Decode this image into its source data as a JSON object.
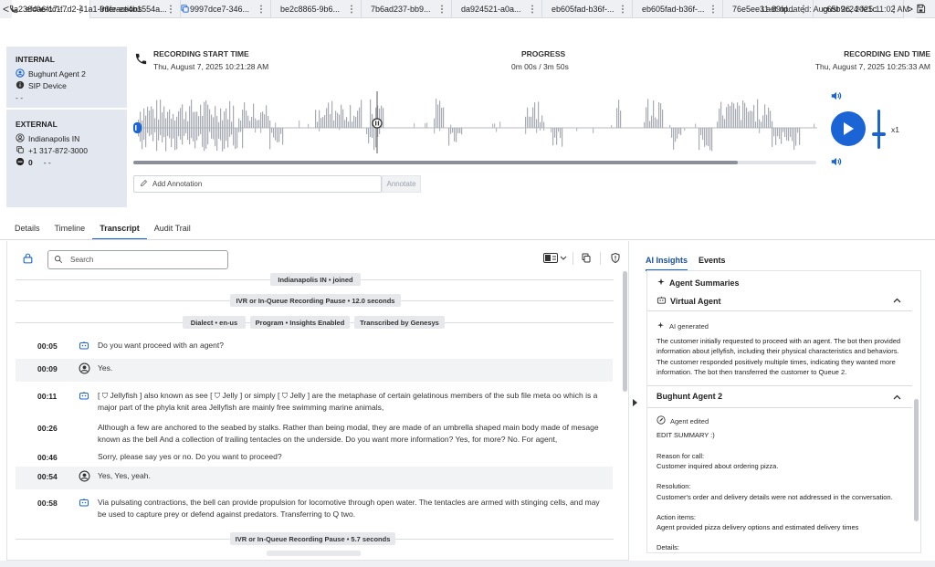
{
  "tabs": [
    "8a236c0e-cc1...",
    "Interactions",
    "9997dce7-346...",
    "be2c8865-9b6...",
    "7b6ad237-bb9...",
    "da924521-a0a...",
    "eb605fad-b36f-...",
    "eb605fad-b36f-...",
    "76e5ee31-89fd...",
    "c65b9c24-fe1c..."
  ],
  "tab_nav": {
    "prev": "<",
    "next": ">"
  },
  "header": {
    "conversation_id": "ef4a6f17-f7d2-41a1-96fe-ee4b1554a...",
    "last_updated": "Last updated: August 26, 2025 11:02 AM"
  },
  "participants": {
    "internal": {
      "label": "INTERNAL",
      "name": "Bughunt Agent 2",
      "device": "SIP Device",
      "extra": "- -"
    },
    "external": {
      "label": "EXTERNAL",
      "name": "Indianapolis IN",
      "phone": "+1 317-872-3000",
      "score": "0",
      "score_extra": "- -"
    }
  },
  "recording": {
    "start_label": "RECORDING START TIME",
    "start_value": "Thu, August 7, 2025 10:21:28 AM",
    "progress_label": "PROGRESS",
    "progress_value": "0m 00s / 3m 50s",
    "end_label": "RECORDING END TIME",
    "end_value": "Thu, August 7, 2025 10:25:33 AM",
    "speed": "x1",
    "seek_fraction": 0.885
  },
  "annotation": {
    "placeholder": "Add Annotation",
    "button": "Annotate"
  },
  "section_tabs": [
    "Details",
    "Timeline",
    "Transcript",
    "Audit Trail"
  ],
  "transcript": {
    "search_placeholder": "Search",
    "events": {
      "joined": "Indianapolis IN • joined",
      "pause1": "IVR or In-Queue Recording Pause • 12.0 seconds",
      "dialect": "Dialect • en-us",
      "program": "Program • Insights Enabled",
      "transcribed": "Transcribed by Genesys",
      "pause2": "IVR or In-Queue Recording Pause • 5.7 seconds"
    },
    "lines": [
      {
        "time": "00:05",
        "speaker": "bot",
        "text": "Do you want proceed with an agent?"
      },
      {
        "time": "00:09",
        "speaker": "customer",
        "text": "Yes."
      },
      {
        "time": "00:11",
        "speaker": "bot",
        "text": "[ ⛉ Jellyfish ] also known as see [ ⛉ Jelly ] or simply [ ⛉ Jelly ] are the metaphase of certain gelatinous members of the sub file meta oo which is a major part of the phyla knit area Jellyfish are mainly free swimming marine animals,"
      },
      {
        "time": "00:26",
        "speaker": "none",
        "text": "Although a few are anchored to the seabed by stalks. Rather than being modal, they are made of an umbrella shaped main body made of mesage known as the bell And a collection of trailing tentacles on the underside. Do you want more information? Yes, for more? No. For agent,"
      },
      {
        "time": "00:46",
        "speaker": "none",
        "text": "Sorry, please say yes or no. Do you want to proceed?"
      },
      {
        "time": "00:54",
        "speaker": "customer",
        "text": "Yes, Yes, yeah."
      },
      {
        "time": "00:58",
        "speaker": "bot",
        "text": "Via pulsating contractions, the bell can provide propulsion for locomotive through open water. The tentacles are armed with stinging cells, and may be used to capture prey or defend against predators. Transferring to Q two."
      }
    ]
  },
  "insights": {
    "tabs": [
      "AI Insights",
      "Events"
    ],
    "title": "Agent Summaries",
    "virtual_agent": {
      "name": "Virtual Agent",
      "tag": "AI generated",
      "summary": "The customer initially requested to proceed with an agent. The bot then provided information about jellyfish, including their physical characteristics and behaviors. The customer responded positively multiple times, indicating they wanted more information. The bot then transferred the customer to Queue 2."
    },
    "agent": {
      "name": "Bughunt Agent 2",
      "tag": "Agent edited",
      "summary_title": "EDIT SUMMARY :)",
      "reason_label": "Reason for call:",
      "reason": "Customer inquired about ordering pizza.",
      "resolution_label": "Resolution:",
      "resolution": "Customer's order and delivery details were not addressed in the conversation.",
      "actions_label": "Action items:",
      "actions": "Agent provided pizza delivery options and estimated delivery times",
      "details_label": "Details:"
    }
  },
  "colors": {
    "accent": "#1a64d6",
    "panel": "#e3e7ef"
  }
}
